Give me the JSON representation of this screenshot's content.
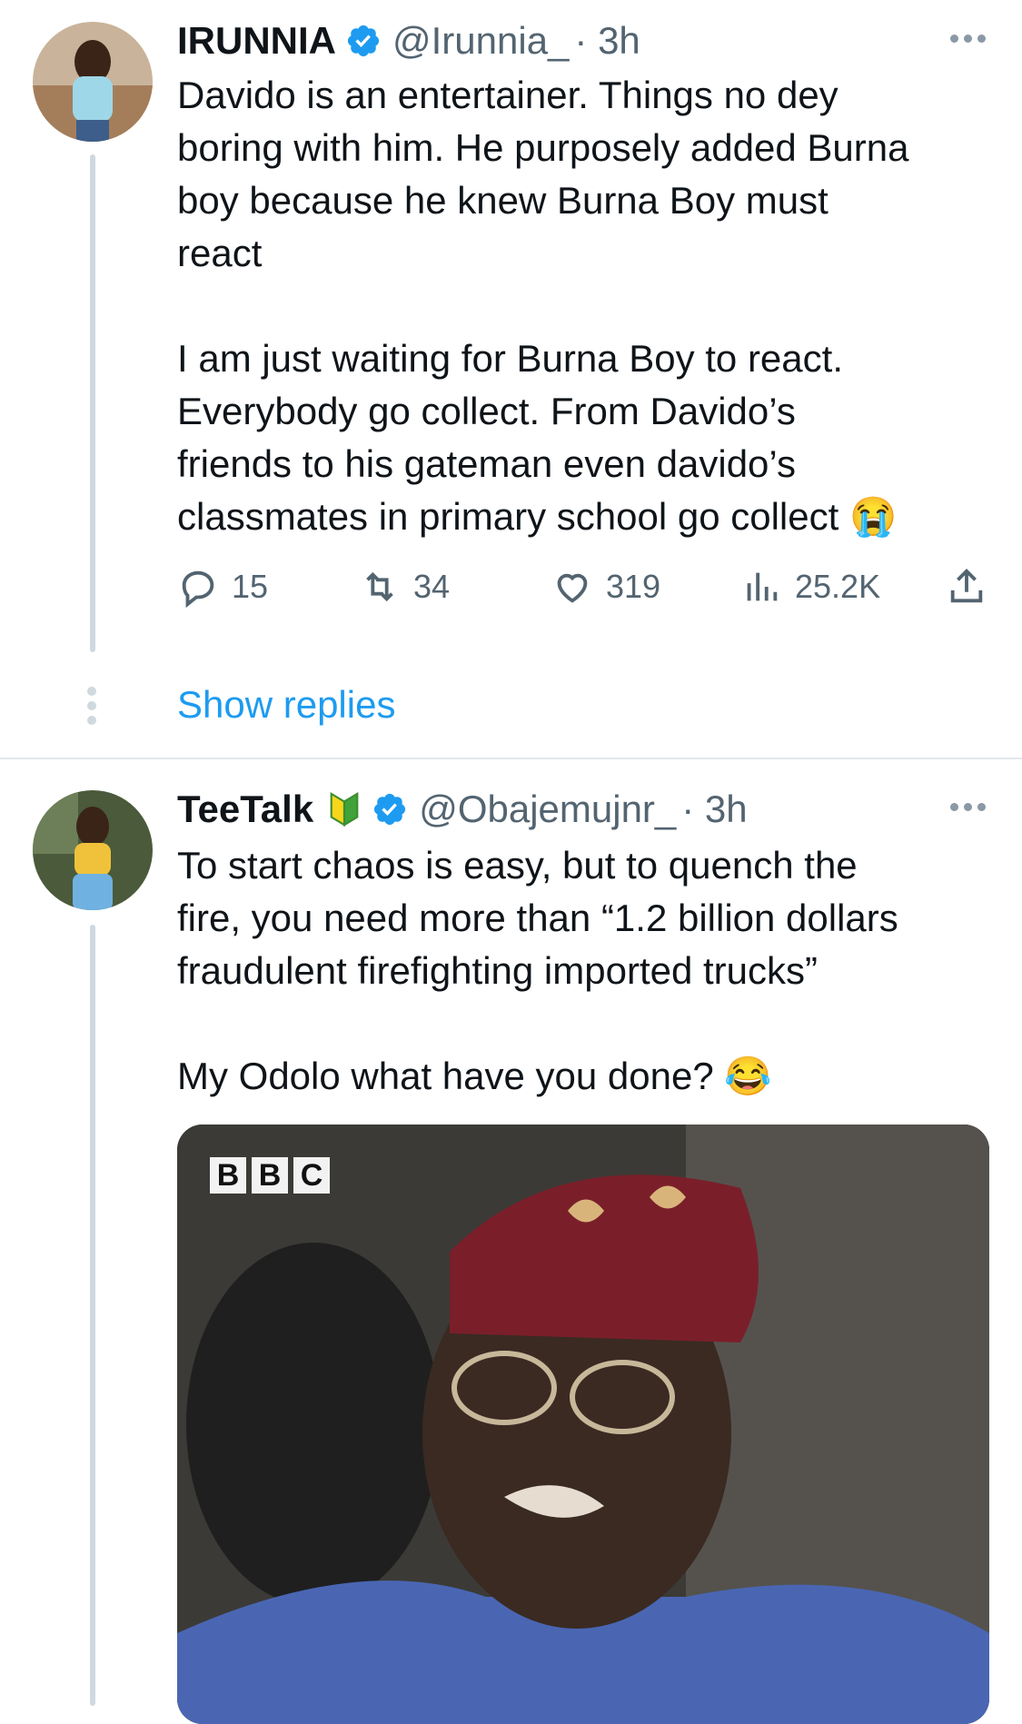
{
  "tweets": [
    {
      "name": "IRUNNIA",
      "handle": "@Irunnia_",
      "time": "· 3h",
      "lines": [
        "Davido is an entertainer. Things no dey",
        "boring with him. He purposely added Burna",
        "boy because he knew Burna Boy must",
        "react",
        "",
        "I am just waiting for Burna Boy to react.",
        "Everybody go collect. From Davido’s",
        "friends to his gateman even davido’s",
        "classmates in primary school go collect 😭"
      ],
      "actions": {
        "replies": "15",
        "retweets": "34",
        "likes": "319",
        "views": "25.2K"
      },
      "show_replies": "Show replies"
    },
    {
      "name": "TeeTalk",
      "handle": "@Obajemujnr_",
      "time": "· 3h",
      "lines": [
        "To start chaos is easy, but to quench the",
        "fire, you need more than “1.2 billion dollars",
        "fraudulent firefighting imported trucks”",
        "",
        "My Odolo what have you done? 😂"
      ],
      "media": {
        "logo": [
          "B",
          "B",
          "C"
        ]
      }
    }
  ],
  "colors": {
    "link": "#1d9bf0",
    "verified": "#1d9bf0",
    "secondary_text": "#536471"
  },
  "icons": [
    "reply-icon",
    "retweet-icon",
    "like-icon",
    "views-icon",
    "share-icon",
    "verified-badge-icon",
    "more-icon",
    "beginner-mark-icon"
  ]
}
